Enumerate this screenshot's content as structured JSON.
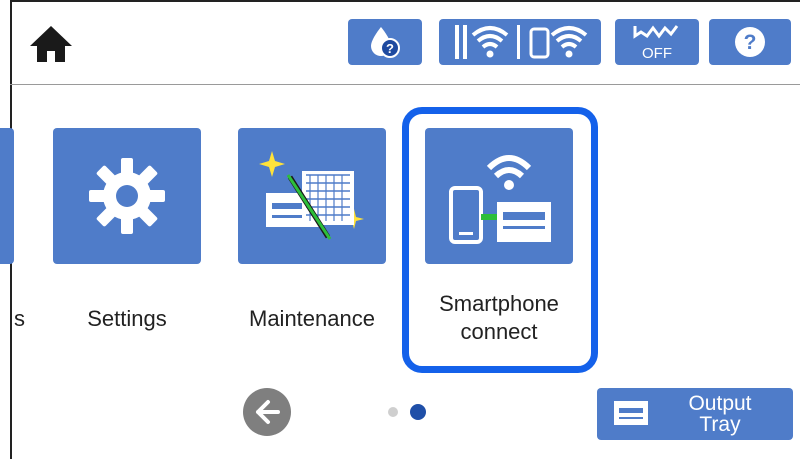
{
  "status_bar": {
    "ink_icon": "ink-help-icon",
    "network_icons": [
      "wifi-router-icon",
      "wifi-direct-icon"
    ],
    "wifi_direct_status_icon": "wifi-direct-off-icon",
    "wifi_direct_status_text": "OFF",
    "help_icon": "help-icon",
    "help_label": "?"
  },
  "menu": {
    "partial_label": "s",
    "items": [
      {
        "label": "Settings",
        "icon": "gear-icon"
      },
      {
        "label": "Maintenance",
        "icon": "maintenance-icon"
      },
      {
        "label_line1": "Smartphone",
        "label_line2": "connect",
        "icon": "smartphone-connect-icon",
        "selected": true
      }
    ]
  },
  "pagination": {
    "total": 2,
    "current": 2
  },
  "output_tray": {
    "line1": "Output",
    "line2": "Tray",
    "icon": "output-tray-icon"
  },
  "colors": {
    "accent": "#4f7cc9",
    "highlight": "#1461ea",
    "active_dot": "#1f4fa8"
  }
}
